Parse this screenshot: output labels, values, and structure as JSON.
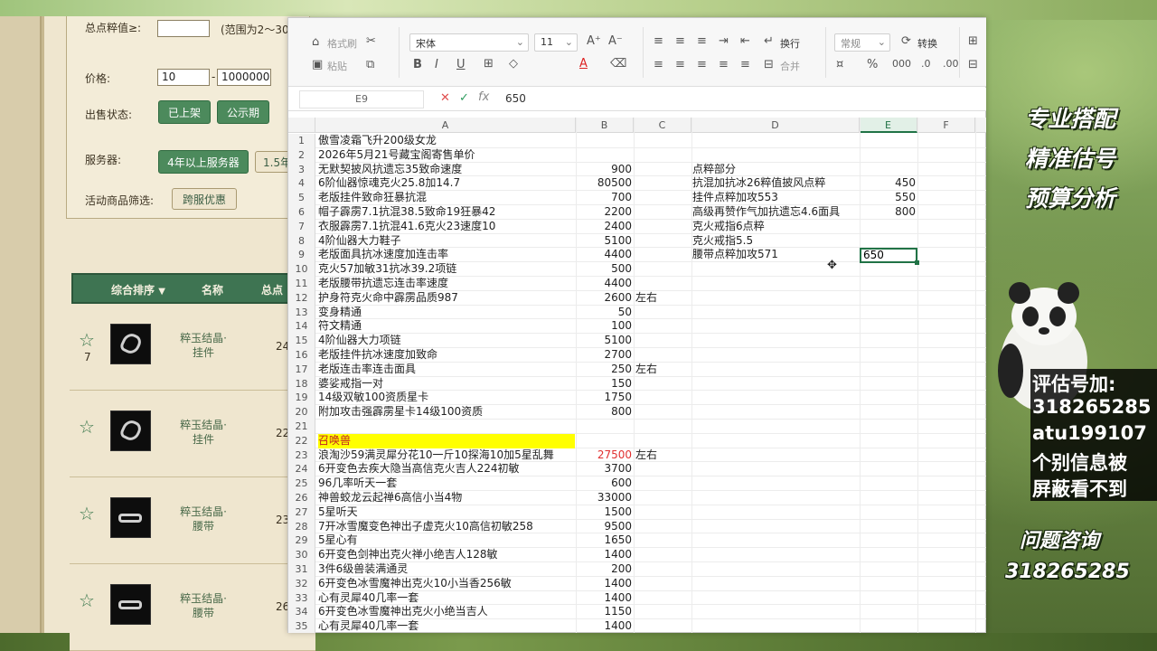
{
  "shop": {
    "filter": {
      "score_label": "总点粹值≥:",
      "score_value": "",
      "score_hint": "(范围为2～30",
      "price_label": "价格:",
      "price_min": "10",
      "price_sep": "-",
      "price_max": "1000000",
      "status_label": "出售状态:",
      "status_buttons": [
        "已上架",
        "公示期"
      ],
      "server_label": "服务器:",
      "server_buttons": [
        "4年以上服务器",
        "1.5年"
      ],
      "activity_label": "活动商品筛选:",
      "activity_button": "跨服优惠"
    },
    "list_header": {
      "sort": "综合排序",
      "sort_arrow": "▼",
      "name": "名称",
      "points": "总点"
    },
    "items": [
      {
        "count": "7",
        "name": "粹玉结晶·挂件",
        "points": "24"
      },
      {
        "count": "",
        "name": "粹玉结晶·挂件",
        "points": "22"
      },
      {
        "count": "",
        "name": "粹玉结晶·腰带",
        "points": "23"
      },
      {
        "count": "",
        "name": "粹玉结晶·腰带",
        "points": "26"
      }
    ]
  },
  "ribbon": {
    "format_painter": "格式刷",
    "paste": "粘贴",
    "font_name": "宋体",
    "font_size": "11",
    "wrap": "换行",
    "merge": "合并",
    "number_format": "常规",
    "convert": "转换"
  },
  "formula_bar": {
    "cell_ref": "E9",
    "value": "650"
  },
  "columns": [
    "A",
    "B",
    "C",
    "D",
    "E",
    "F"
  ],
  "selected_column": "E",
  "rows": [
    {
      "n": "1",
      "a": "傲雪凌霜飞升200级女龙",
      "b": "",
      "c": "",
      "d": "",
      "e": ""
    },
    {
      "n": "2",
      "a": "2026年5月21号藏宝阁寄售单价",
      "b": "",
      "c": "",
      "d": "",
      "e": ""
    },
    {
      "n": "3",
      "a": "无默契披风抗遗忘35致命速度",
      "b": "900",
      "c": "",
      "d": "点粹部分",
      "e": ""
    },
    {
      "n": "4",
      "a": "6阶仙器惊魂克火25.8加14.7",
      "b": "80500",
      "c": "",
      "d": "抗混加抗冰26粹值披风点粹",
      "e": "450"
    },
    {
      "n": "5",
      "a": "老版挂件致命狂暴抗混",
      "b": "700",
      "c": "",
      "d": "挂件点粹加攻553",
      "e": "550"
    },
    {
      "n": "6",
      "a": "帽子霹雳7.1抗混38.5致命19狂暴42",
      "b": "2200",
      "c": "",
      "d": "高级再赞作气加抗遗忘4.6面具",
      "e": "800"
    },
    {
      "n": "7",
      "a": "衣服霹雳7.1抗混41.6克火23速度10",
      "b": "2400",
      "c": "",
      "d": "克火戒指6点粹",
      "e": ""
    },
    {
      "n": "8",
      "a": "4阶仙器大力鞋子",
      "b": "5100",
      "c": "",
      "d": "克火戒指5.5",
      "e": ""
    },
    {
      "n": "9",
      "a": "老版面具抗冰速度加连击率",
      "b": "4400",
      "c": "",
      "d": "腰带点粹加攻571",
      "e": ""
    },
    {
      "n": "10",
      "a": "克火57加敏31抗冰39.2项链",
      "b": "500",
      "c": "",
      "d": "",
      "e": ""
    },
    {
      "n": "11",
      "a": "老版腰带抗遗忘连击率速度",
      "b": "4400",
      "c": "",
      "d": "",
      "e": ""
    },
    {
      "n": "12",
      "a": "护身符克火命中霹雳品质987",
      "b": "2600",
      "c": "左右",
      "d": "",
      "e": ""
    },
    {
      "n": "13",
      "a": "变身精通",
      "b": "50",
      "c": "",
      "d": "",
      "e": ""
    },
    {
      "n": "14",
      "a": "符文精通",
      "b": "100",
      "c": "",
      "d": "",
      "e": ""
    },
    {
      "n": "15",
      "a": "4阶仙器大力项链",
      "b": "5100",
      "c": "",
      "d": "",
      "e": ""
    },
    {
      "n": "16",
      "a": "老版挂件抗冰速度加致命",
      "b": "2700",
      "c": "",
      "d": "",
      "e": ""
    },
    {
      "n": "17",
      "a": "老版连击率连击面具",
      "b": "250",
      "c": "左右",
      "d": "",
      "e": ""
    },
    {
      "n": "18",
      "a": "婆娑戒指一对",
      "b": "150",
      "c": "",
      "d": "",
      "e": ""
    },
    {
      "n": "19",
      "a": "14级双敏100资质星卡",
      "b": "1750",
      "c": "",
      "d": "",
      "e": ""
    },
    {
      "n": "20",
      "a": "附加攻击强霹雳星卡14级100资质",
      "b": "800",
      "c": "",
      "d": "",
      "e": ""
    },
    {
      "n": "21",
      "a": "",
      "b": "",
      "c": "",
      "d": "",
      "e": ""
    },
    {
      "n": "22",
      "a": "召唤兽",
      "b": "",
      "c": "",
      "d": "",
      "e": "",
      "highlight": true
    },
    {
      "n": "23",
      "a": "浪淘沙59满灵犀分花10一斤10探海10加5星乱舞",
      "b": "27500",
      "c": "左右",
      "d": "",
      "e": "",
      "red_b": true
    },
    {
      "n": "24",
      "a": "6开变色去疾大隐当高信克火吉人224初敏",
      "b": "3700",
      "c": "",
      "d": "",
      "e": ""
    },
    {
      "n": "25",
      "a": "96几率听天一套",
      "b": "600",
      "c": "",
      "d": "",
      "e": ""
    },
    {
      "n": "26",
      "a": "神兽蛟龙云起禅6高信小当4物",
      "b": "33000",
      "c": "",
      "d": "",
      "e": ""
    },
    {
      "n": "27",
      "a": "5星听天",
      "b": "1500",
      "c": "",
      "d": "",
      "e": ""
    },
    {
      "n": "28",
      "a": "7开冰雪魔变色神出子虚克火10高信初敏258",
      "b": "9500",
      "c": "",
      "d": "",
      "e": ""
    },
    {
      "n": "29",
      "a": "5星心有",
      "b": "1650",
      "c": "",
      "d": "",
      "e": ""
    },
    {
      "n": "30",
      "a": "6开变色剑神出克火禅小绝吉人128敏",
      "b": "1400",
      "c": "",
      "d": "",
      "e": ""
    },
    {
      "n": "31",
      "a": "3件6级兽装满通灵",
      "b": "200",
      "c": "",
      "d": "",
      "e": ""
    },
    {
      "n": "32",
      "a": "6开变色冰雪魔神出克火10小当香256敏",
      "b": "1400",
      "c": "",
      "d": "",
      "e": ""
    },
    {
      "n": "33",
      "a": "心有灵犀40几率一套",
      "b": "1400",
      "c": "",
      "d": "",
      "e": ""
    },
    {
      "n": "34",
      "a": "6开变色冰雪魔神出克火小绝当吉人",
      "b": "1150",
      "c": "",
      "d": "",
      "e": ""
    },
    {
      "n": "35",
      "a": "心有灵犀40几率一套",
      "b": "1400",
      "c": "",
      "d": "",
      "e": ""
    }
  ],
  "active_cell": {
    "ref": "E9",
    "value": "650"
  },
  "promo": {
    "line1": "专业搭配",
    "line2": "精准估号",
    "line3": "预算分析",
    "contact_lines": [
      "评估号加:",
      "318265285",
      "atu199107",
      "个别信息被",
      "屏蔽看不到"
    ],
    "consult": "问题咨询",
    "consult_number": "318265285"
  },
  "colors": {
    "accent_green": "#217346",
    "shop_green": "#4c8a5c",
    "highlight_yellow": "#ffff00",
    "price_red": "#e03030"
  }
}
